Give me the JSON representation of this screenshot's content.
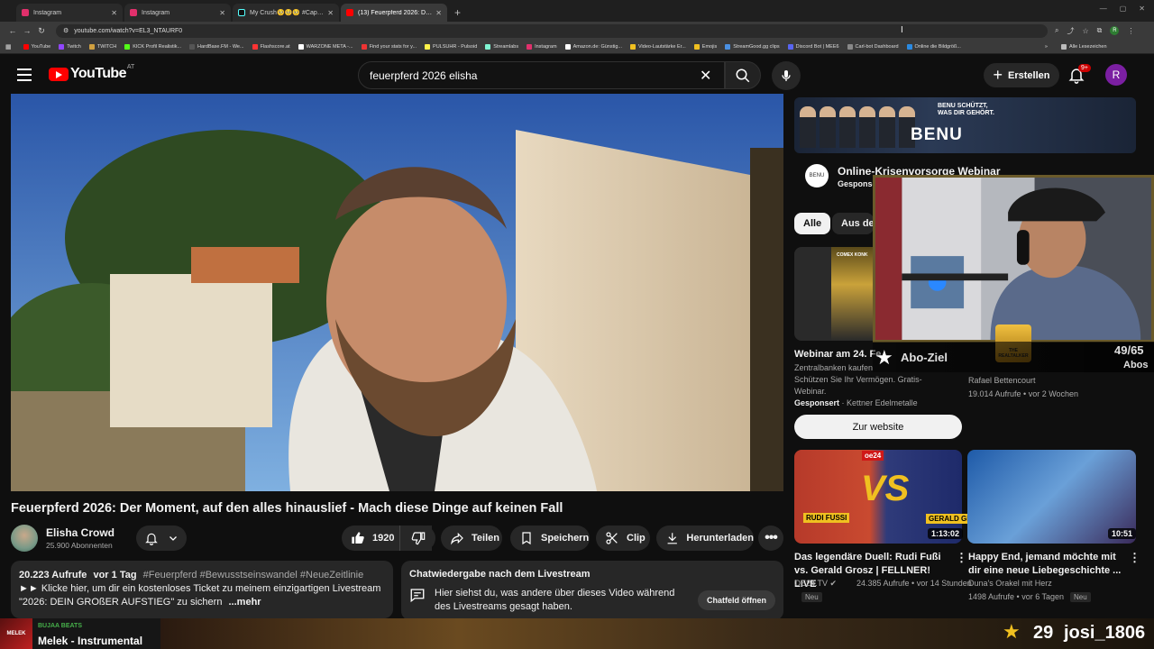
{
  "browser": {
    "tabs": [
      {
        "title": "Instagram",
        "color": "#e1306c",
        "active": false
      },
      {
        "title": "Instagram",
        "color": "#e1306c",
        "active": false
      },
      {
        "title": "My Crush🥺🥺🥺 #CapCut #",
        "color": "#000000",
        "active": false
      },
      {
        "title": "(13) Feuerpferd 2026: Der Mom",
        "color": "#ff0000",
        "active": true
      }
    ],
    "url": "youtube.com/watch?v=EL3_NTAURF0",
    "profile_initial": "R",
    "bookmarks": [
      {
        "label": "YouTube",
        "color": "#ff0000"
      },
      {
        "label": "Twitch",
        "color": "#9146ff"
      },
      {
        "label": "TWITCH",
        "color": "#d0a040"
      },
      {
        "label": "KICK Profil Realistik...",
        "color": "#53fc18"
      },
      {
        "label": "HardBase.FM - We...",
        "color": "#555555"
      },
      {
        "label": "Flashscore.at",
        "color": "#ff3333"
      },
      {
        "label": "WARZONE META -...",
        "color": "#ffffff"
      },
      {
        "label": "Find your stats for y...",
        "color": "#e33"
      },
      {
        "label": "PULSUHR - Pulsoid",
        "color": "#fff24a"
      },
      {
        "label": "Streamlabs",
        "color": "#80f5d2"
      },
      {
        "label": "Instagram",
        "color": "#e1306c"
      },
      {
        "label": "Amazon.de: Günstig...",
        "color": "#ffffff"
      },
      {
        "label": "Video-Lautstärke Er...",
        "color": "#f0c020"
      },
      {
        "label": "Emojis",
        "color": "#f0c020"
      },
      {
        "label": "StreamGood.gg clips",
        "color": "#4a90e2"
      },
      {
        "label": "Discord Bot | MEE6",
        "color": "#5865f2"
      },
      {
        "label": "Carl-bot Dashboard",
        "color": "#888888"
      },
      {
        "label": "Online die Bildgröß...",
        "color": "#2a8ae2"
      }
    ],
    "bookmarks_more": "»",
    "all_bookmarks": "Alle Lesezeichen"
  },
  "header": {
    "logo_text": "YouTube",
    "country_code": "AT",
    "search_value": "feuerpferd 2026 elisha",
    "create_label": "Erstellen",
    "notifications_badge": "9+",
    "avatar_initial": "R"
  },
  "video": {
    "title": "Feuerpferd 2026: Der Moment, auf den alles hinauslief - Mach diese Dinge auf keinen Fall",
    "channel_name": "Elisha Crowd",
    "subscribers": "25.900 Abonnenten",
    "likes": "1920",
    "share_label": "Teilen",
    "save_label": "Speichern",
    "clip_label": "Clip",
    "download_label": "Herunterladen",
    "description": {
      "views": "20.223 Aufrufe",
      "date": "vor 1 Tag",
      "hashtags": "#Feuerpferd #Bewusstseinswandel #NeueZeitlinie",
      "line1": "►► Klicke hier, um dir ein kostenloses Ticket zu meinem einzigartigen Livestream",
      "line2": "\"2026: DEIN GROßER AUFSTIEG\" zu sichern",
      "more": "...mehr"
    },
    "chat_replay": {
      "title": "Chatwiedergabe nach dem Livestream",
      "text": "Hier siehst du, was andere über dieses Video während des Livestreams gesagt haben.",
      "button": "Chatfeld öffnen"
    }
  },
  "sidebar": {
    "ad_banner": {
      "brand": "BENU",
      "slogan_1": "BENU SCHÜTZT,",
      "slogan_2": "WAS DIR GEHÖRT.",
      "logo_text": "BENU",
      "title": "Online-Krisenvorsorge Webinar",
      "sponsored": "Gesponsert"
    },
    "chips": [
      "Alle",
      "Aus deinen Suchanfragen"
    ],
    "ad2": {
      "image_text": "COMEX KONK",
      "title": "Webinar am 24. Fe",
      "desc_1": "Zentralbanken kaufen",
      "desc_2": "Schützen Sie Ihr Vermögen. Gratis-",
      "desc_3": "Webinar.",
      "sponsored": "Gesponsert",
      "advertiser": "Kettner Edelmetalle",
      "button": "Zur website"
    },
    "video2": {
      "channel": "Rafael Bettencourt",
      "meta": "19.014 Aufrufe • vor 2 Wochen"
    },
    "videos": [
      {
        "title": "Das legendäre Duell: Rudi Fußi vs. Gerald Grosz | FELLNER! LIVE",
        "channel": "OE24.TV",
        "meta": "24.385 Aufrufe • vor 14 Stunden",
        "badge": "Neu",
        "duration": "1:13:02",
        "thumb_label": "oe24",
        "thumb_vs": "VS",
        "thumb_name_1": "RUDI FUSSI",
        "thumb_name_2": "GERALD GR"
      },
      {
        "title": "Happy End, jemand möchte mit dir eine neue Liebegeschichte ...",
        "channel": "Duna's Orakel mit Herz",
        "meta": "1498 Aufrufe • vor 6 Tagen",
        "badge": "Neu",
        "duration": "10:51"
      }
    ]
  },
  "stream_overlay": {
    "abo_label": "Abo-Ziel",
    "abo_count": "49/65",
    "abo_unit": "Abos",
    "music_artist": "BUJAA BEATS",
    "music_track": "Melek - Instrumental",
    "music_cover_text": "MELEK",
    "sub_count": "29",
    "sub_name": "josi_1806",
    "sticker_text": "THE REALTALKER"
  }
}
